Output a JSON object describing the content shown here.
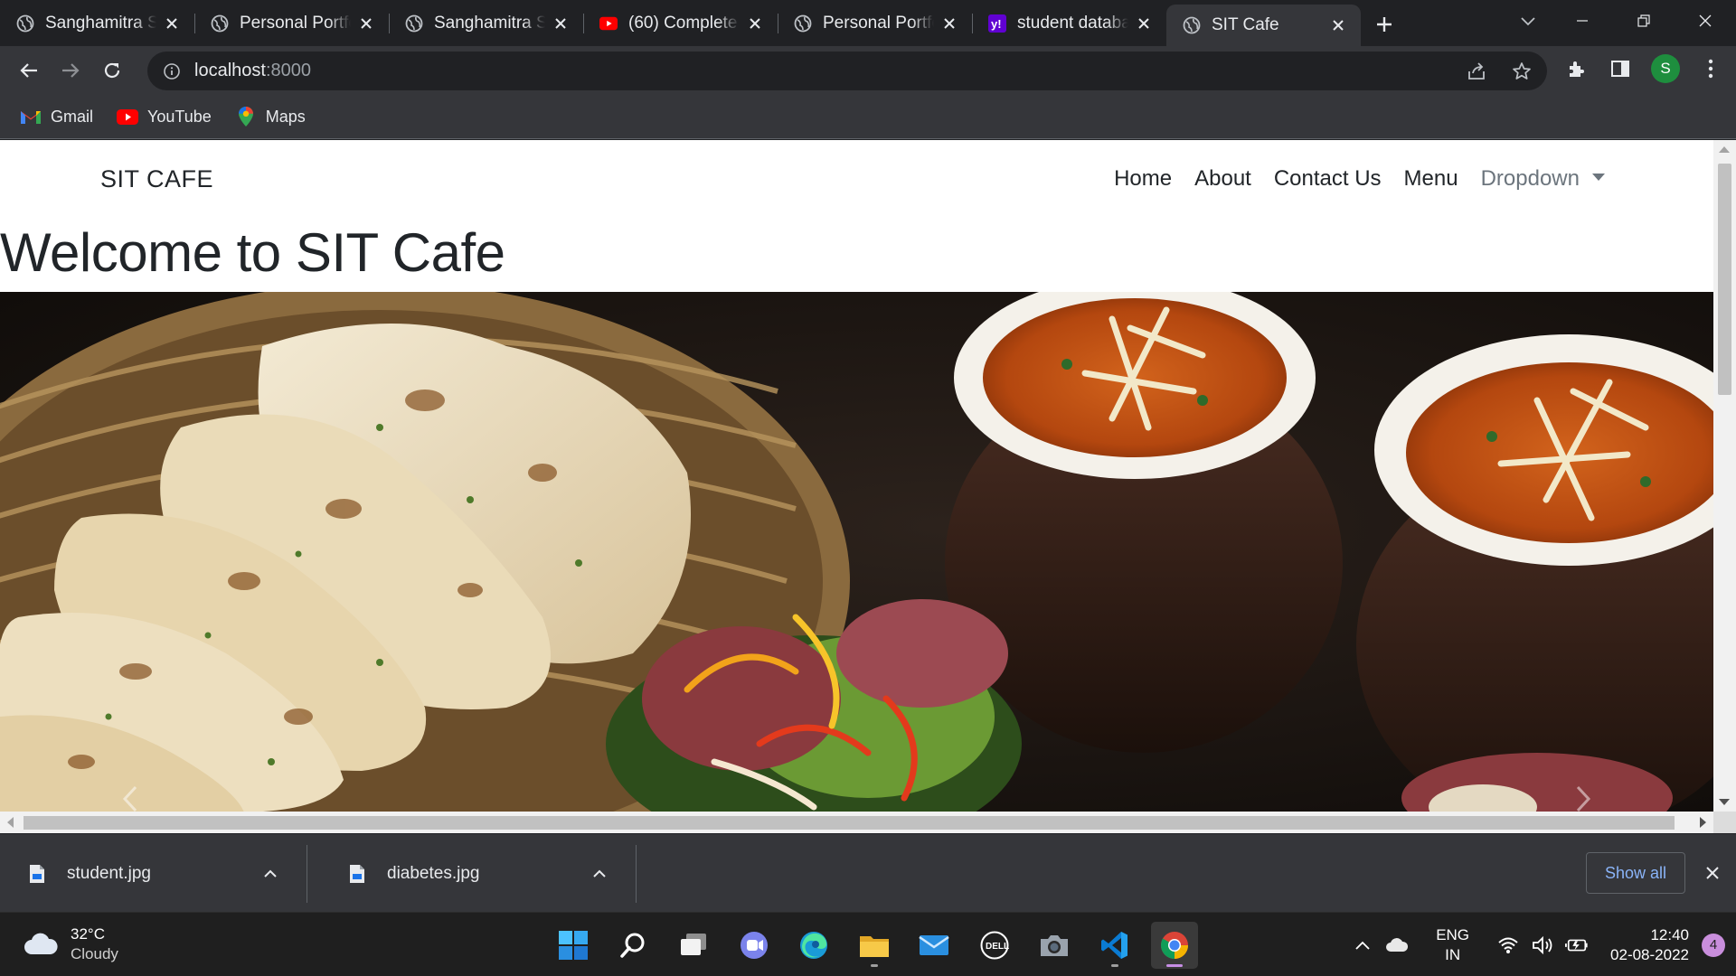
{
  "browser": {
    "tabs": [
      {
        "title": "Sanghamitra Sa",
        "icon": "globe-icon"
      },
      {
        "title": "Personal Portfo",
        "icon": "globe-icon"
      },
      {
        "title": "Sanghamitra Sa",
        "icon": "globe-icon"
      },
      {
        "title": "(60) Complete",
        "icon": "youtube-icon"
      },
      {
        "title": "Personal Portfo",
        "icon": "globe-icon"
      },
      {
        "title": "student databa",
        "icon": "yahoo-icon"
      },
      {
        "title": "SIT Cafe",
        "icon": "globe-icon",
        "active": true
      }
    ],
    "address": {
      "host": "localhost",
      "port": ":8000"
    },
    "profile_initial": "S",
    "bookmarks": [
      {
        "label": "Gmail",
        "icon": "gmail-icon"
      },
      {
        "label": "YouTube",
        "icon": "youtube-icon"
      },
      {
        "label": "Maps",
        "icon": "maps-icon"
      }
    ]
  },
  "site": {
    "brand": "SIT CAFE",
    "nav": [
      "Home",
      "About",
      "Contact Us",
      "Menu"
    ],
    "dropdown": "Dropdown",
    "heading": "Welcome to SIT Cafe",
    "hero_icon": "food-photo-naan-curry"
  },
  "downloads": {
    "items": [
      {
        "name": "student.jpg"
      },
      {
        "name": "diabetes.jpg"
      }
    ],
    "show_all": "Show all"
  },
  "taskbar": {
    "weather": {
      "temp": "32°C",
      "condition": "Cloudy"
    },
    "apps": [
      "windows-start-icon",
      "search-icon",
      "task-view-icon",
      "teams-chat-icon",
      "edge-icon",
      "file-explorer-icon",
      "mail-icon",
      "dell-icon",
      "camera-icon",
      "vscode-icon",
      "chrome-icon"
    ],
    "lang": {
      "line1": "ENG",
      "line2": "IN"
    },
    "clock": {
      "time": "12:40",
      "date": "02-08-2022"
    },
    "notifications": "4"
  },
  "colors": {
    "chrome_dark": "#202124",
    "chrome_toolbar": "#35363a",
    "link_blue": "#8ab4f8",
    "text_dark": "#212529",
    "muted": "#6c757d"
  }
}
